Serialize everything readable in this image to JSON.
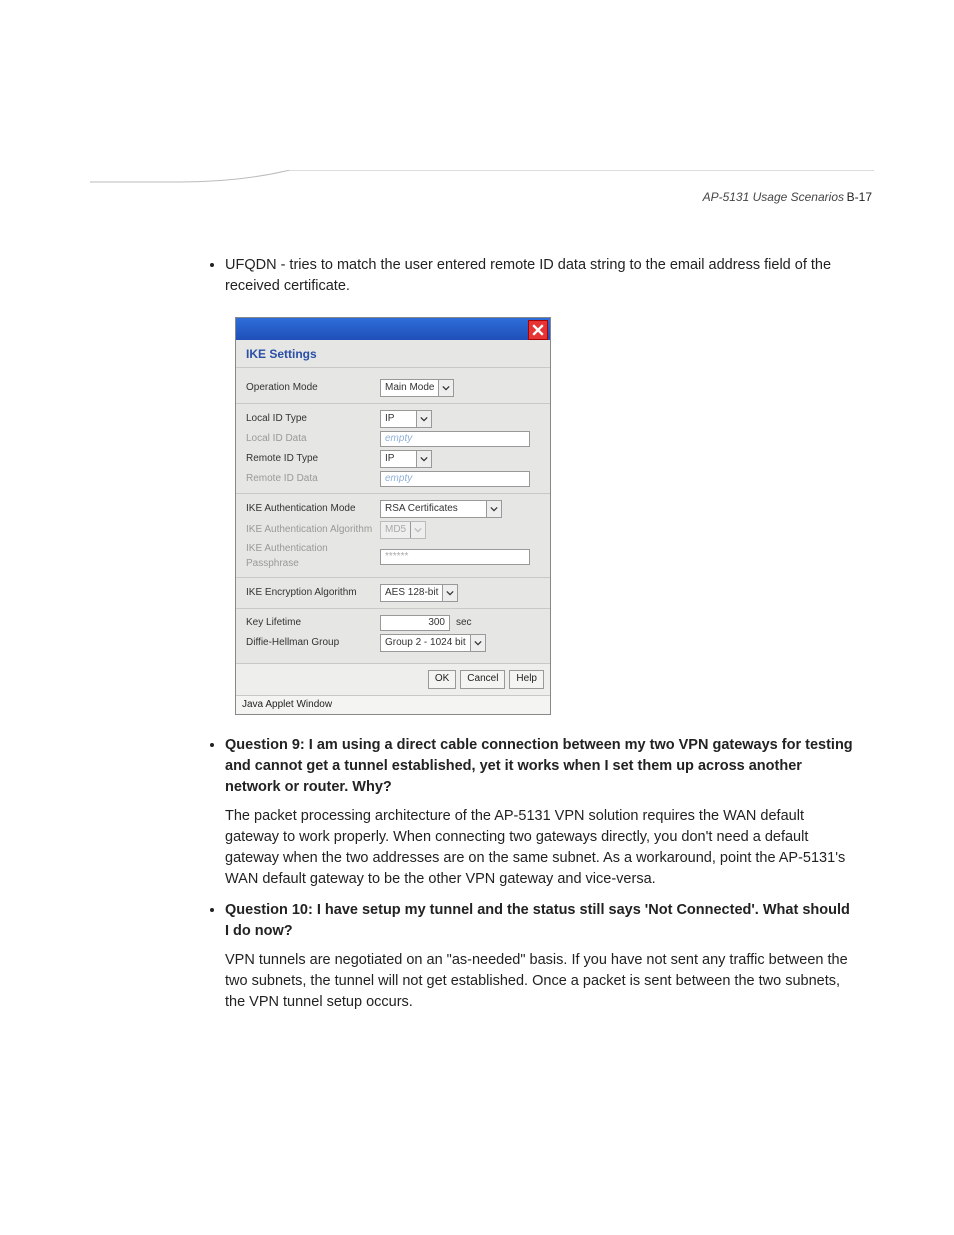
{
  "header": {
    "title": "AP-5131 Usage Scenarios",
    "page_number": "B-17"
  },
  "bullets": [
    {
      "text": "UFQDN - tries to match the user entered remote ID data string to the email address field of the received certificate."
    },
    {
      "question": "Question 9: I am using a direct cable connection between my two VPN gateways for testing and cannot get a tunnel established, yet it works when I set them up across another network or router. Why?",
      "answer": "The packet processing architecture of the AP-5131 VPN solution requires the WAN default gateway to work properly. When connecting two gateways directly, you don't need a default gateway when the two addresses are on the same subnet. As a workaround, point the AP-5131's WAN default gateway to be the other VPN gateway and vice-versa."
    },
    {
      "question": "Question 10: I have setup my tunnel and the status still says 'Not Connected'. What should I do now?",
      "answer": "VPN tunnels are negotiated on an \"as-needed\" basis. If you have not sent any traffic between the two subnets, the tunnel will not get established. Once a packet is sent between the two subnets, the VPN tunnel setup occurs."
    }
  ],
  "dialog": {
    "heading": "IKE Settings",
    "fields": {
      "operation_mode": {
        "label": "Operation Mode",
        "value": "Main Mode"
      },
      "local_id_type": {
        "label": "Local ID Type",
        "value": "IP"
      },
      "local_id_data": {
        "label": "Local ID Data",
        "value": "empty"
      },
      "remote_id_type": {
        "label": "Remote ID Type",
        "value": "IP"
      },
      "remote_id_data": {
        "label": "Remote ID Data",
        "value": "empty"
      },
      "ike_auth_mode": {
        "label": "IKE Authentication Mode",
        "value": "RSA Certificates"
      },
      "ike_auth_algo": {
        "label": "IKE Authentication Algorithm",
        "value": "MD5"
      },
      "ike_auth_pass": {
        "label": "IKE Authentication Passphrase",
        "value": "******"
      },
      "ike_enc_algo": {
        "label": "IKE Encryption Algorithm",
        "value": "AES 128-bit"
      },
      "key_lifetime": {
        "label": "Key Lifetime",
        "value": "300",
        "unit": "sec"
      },
      "dh_group": {
        "label": "Diffie-Hellman Group",
        "value": "Group 2 - 1024 bit"
      }
    },
    "buttons": {
      "ok": "OK",
      "cancel": "Cancel",
      "help": "Help"
    },
    "status": "Java Applet Window"
  }
}
